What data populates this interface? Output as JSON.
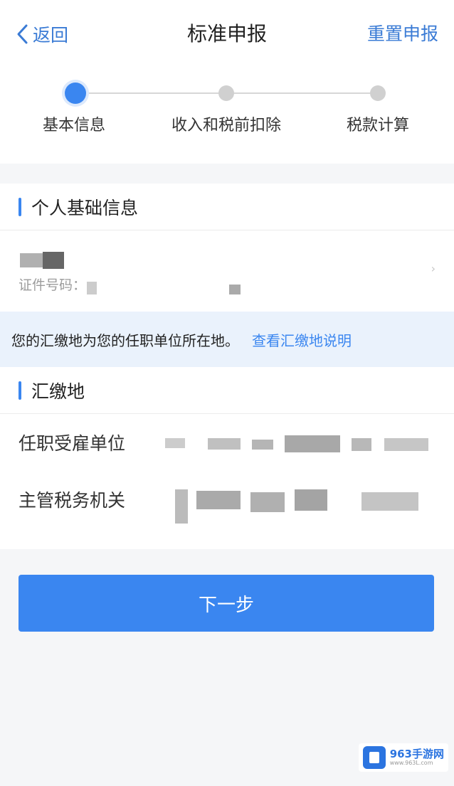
{
  "nav": {
    "back_label": "返回",
    "title": "标准申报",
    "reset_label": "重置申报"
  },
  "steps": [
    {
      "label": "基本信息",
      "active": true
    },
    {
      "label": "收入和税前扣除",
      "active": false
    },
    {
      "label": "税款计算",
      "active": false
    }
  ],
  "personal": {
    "section_title": "个人基础信息",
    "id_label": "证件号码："
  },
  "notice": {
    "message": "您的汇缴地为您的任职单位所在地。",
    "link": "查看汇缴地说明"
  },
  "payment_place": {
    "section_title": "汇缴地",
    "fields": [
      {
        "label": "任职受雇单位"
      },
      {
        "label": "主管税务机关"
      }
    ]
  },
  "next_button": "下一步",
  "watermark": {
    "brand": "963手游网",
    "url": "www.963L.com"
  },
  "colors": {
    "accent": "#3a86f0",
    "link": "#3a7bd5",
    "notice_bg": "#eaf2fc"
  }
}
